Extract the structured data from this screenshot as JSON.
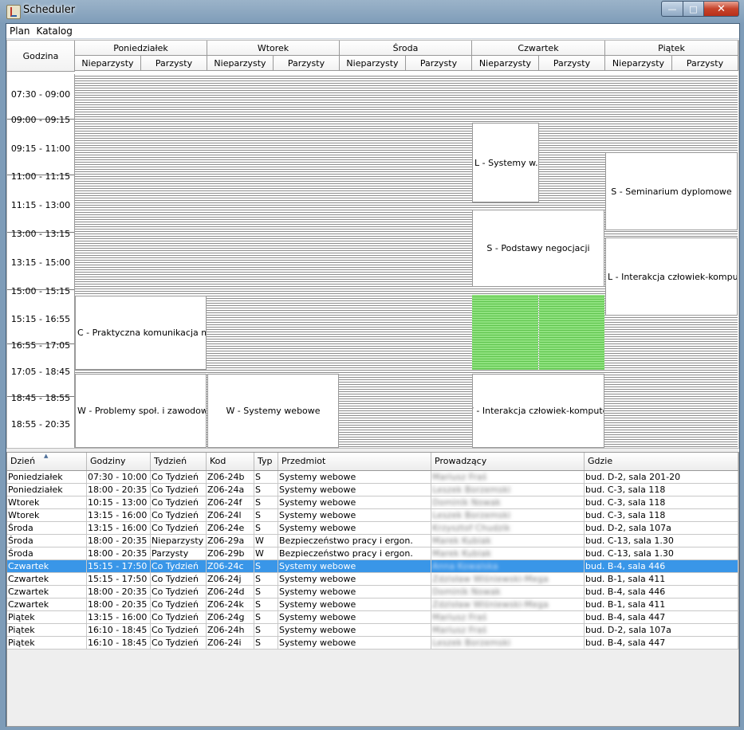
{
  "window": {
    "title": "Scheduler",
    "min_glyph": "—",
    "max_glyph": "□",
    "close_glyph": "✕"
  },
  "menu": [
    "Plan",
    "Katalog"
  ],
  "grid": {
    "hour_header": "Godzina",
    "days": [
      "Poniedziałek",
      "Wtorek",
      "Środa",
      "Czwartek",
      "Piątek"
    ],
    "week_types": [
      "Nieparzysty",
      "Parzysty"
    ],
    "time_slots": [
      "07:30 - 09:00",
      "09:00 - 09:15",
      "09:15 - 11:00",
      "11:00 - 11:15",
      "11:15 - 13:00",
      "13:00 - 13:15",
      "13:15 - 15:00",
      "15:00 - 15:15",
      "15:15 - 16:55",
      "16:55 - 17:05",
      "17:05 - 18:45",
      "18:45 - 18:55",
      "18:55 - 20:35"
    ],
    "events": [
      "L - Systemy w...",
      "S - Seminarium dyplomowe",
      "S - Podstawy negocjacji",
      "L - Interakcja człowiek-komputer",
      "C - Praktyczna komunikacja mię...",
      "W - Problemy społ. i zawodowe...",
      "W - Systemy webowe",
      "W - Interakcja człowiek-komputer"
    ]
  },
  "table": {
    "columns": [
      "Dzień",
      "Godziny",
      "Tydzień",
      "Kod Grupy",
      "Typ",
      "Przedmiot",
      "Prowadzący",
      "Gdzie"
    ],
    "selected_row": 7,
    "rows": [
      [
        "Poniedziałek",
        "07:30 - 10:00",
        "Co Tydzień",
        "Z06-24b",
        "S",
        "Systemy webowe",
        "Mariusz Fraś",
        "bud. D-2, sala 201-20"
      ],
      [
        "Poniedziałek",
        "18:00 - 20:35",
        "Co Tydzień",
        "Z06-24a",
        "S",
        "Systemy webowe",
        "Leszek Borzemski",
        "bud. C-3, sala 118"
      ],
      [
        "Wtorek",
        "10:15 - 13:00",
        "Co Tydzień",
        "Z06-24f",
        "S",
        "Systemy webowe",
        "Dominik Nowak",
        "bud. C-3, sala 118"
      ],
      [
        "Wtorek",
        "13:15 - 16:00",
        "Co Tydzień",
        "Z06-24l",
        "S",
        "Systemy webowe",
        "Leszek Borzemski",
        "bud. C-3, sala 118"
      ],
      [
        "Środa",
        "13:15 - 16:00",
        "Co Tydzień",
        "Z06-24e",
        "S",
        "Systemy webowe",
        "Krzysztof Chudzik",
        "bud. D-2, sala 107a"
      ],
      [
        "Środa",
        "18:00 - 20:35",
        "Nieparzysty",
        "Z06-29a",
        "W",
        "Bezpieczeństwo pracy i ergon.",
        "Marek Kubiak",
        "bud. C-13, sala 1.30"
      ],
      [
        "Środa",
        "18:00 - 20:35",
        "Parzysty",
        "Z06-29b",
        "W",
        "Bezpieczeństwo pracy i ergon.",
        "Marek Kubiak",
        "bud. C-13, sala 1.30"
      ],
      [
        "Czwartek",
        "15:15 - 17:50",
        "Co Tydzień",
        "Z06-24c",
        "S",
        "Systemy webowe",
        "Anna Kowalska",
        "bud. B-4, sala 446"
      ],
      [
        "Czwartek",
        "15:15 - 17:50",
        "Co Tydzień",
        "Z06-24j",
        "S",
        "Systemy webowe",
        "Zdzisław Wiśniewski-Mega",
        "bud. B-1, sala 411"
      ],
      [
        "Czwartek",
        "18:00 - 20:35",
        "Co Tydzień",
        "Z06-24d",
        "S",
        "Systemy webowe",
        "Dominik Nowak",
        "bud. B-4, sala 446"
      ],
      [
        "Czwartek",
        "18:00 - 20:35",
        "Co Tydzień",
        "Z06-24k",
        "S",
        "Systemy webowe",
        "Zdzisław Wiśniewski-Mega",
        "bud. B-1, sala 411"
      ],
      [
        "Piątek",
        "13:15 - 16:00",
        "Co Tydzień",
        "Z06-24g",
        "S",
        "Systemy webowe",
        "Mariusz Fraś",
        "bud. B-4, sala 447"
      ],
      [
        "Piątek",
        "16:10 - 18:45",
        "Co Tydzień",
        "Z06-24h",
        "S",
        "Systemy webowe",
        "Mariusz Fraś",
        "bud. D-2, sala 107a"
      ],
      [
        "Piątek",
        "16:10 - 18:45",
        "Co Tydzień",
        "Z06-24i",
        "S",
        "Systemy webowe",
        "Leszek Borzemski",
        "bud. B-4, sala 447"
      ]
    ]
  }
}
